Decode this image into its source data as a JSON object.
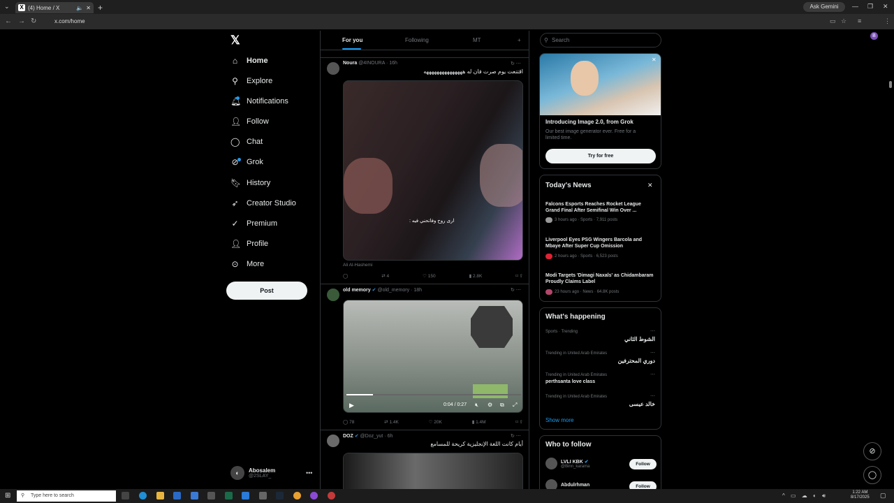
{
  "browser": {
    "tab_title": "(4) Home / X",
    "url": "x.com/home",
    "ask_gemini": "Ask Gemini",
    "profile_letter": "B"
  },
  "nav": {
    "items": [
      {
        "label": "Home",
        "icon": "home-icon"
      },
      {
        "label": "Explore",
        "icon": "search-icon"
      },
      {
        "label": "Notifications",
        "icon": "bell-icon"
      },
      {
        "label": "Follow",
        "icon": "person-add-icon"
      },
      {
        "label": "Chat",
        "icon": "chat-icon"
      },
      {
        "label": "Grok",
        "icon": "grok-icon"
      },
      {
        "label": "History",
        "icon": "bookmark-icon"
      },
      {
        "label": "Creator Studio",
        "icon": "rocket-icon"
      },
      {
        "label": "Premium",
        "icon": "verified-icon"
      },
      {
        "label": "Profile",
        "icon": "person-icon"
      },
      {
        "label": "More",
        "icon": "more-circle-icon"
      }
    ],
    "post_label": "Post",
    "account": {
      "name": "Abosalem",
      "handle": "@2SLAY_"
    }
  },
  "feed": {
    "tabs": [
      "For you",
      "Following",
      "MT"
    ],
    "tweets": [
      {
        "name": "Noura",
        "handle": "@4INOURA",
        "time": "16h",
        "text": "اقتنعت يوم صرت فان له هههههههههههههههه",
        "video_caption": "ارى روح وفاتحني فيه :",
        "credit": "Ali Al-Hashemi",
        "replies": "",
        "reposts": "4",
        "likes": "150",
        "views": "2.8K"
      },
      {
        "name": "old memory",
        "handle": "@old_memory",
        "time": "18h",
        "text": "",
        "video_time": "0:04 / 0:27",
        "replies": "78",
        "reposts": "1.4K",
        "likes": "20K",
        "views": "1.4M"
      },
      {
        "name": "DOZ",
        "handle": "@Doz_yut",
        "time": "6h",
        "text": "أيام كانت اللغة الإنجليزية كريحة للمسامع"
      }
    ]
  },
  "sidebar": {
    "search_placeholder": "Search",
    "promo": {
      "title": "Introducing Image 2.0, from Grok",
      "body": "Our best image generator ever. Free for a limited time.",
      "button": "Try for free"
    },
    "news": {
      "title": "Today's News",
      "items": [
        {
          "headline": "Falcons Esports Reaches Rocket League Grand Final After Semifinal Win Over ...",
          "meta": "3 hours ago · Sports · 7,911 posts"
        },
        {
          "headline": "Liverpool Eyes PSG Wingers Barcola and Mbaye After Super Cup Omission",
          "meta": "2 hours ago · Sports · 6,523 posts"
        },
        {
          "headline": "Modi Targets 'Dimagi Naxals' as Chidambaram Proudly Claims Label",
          "meta": "23 hours ago · News · 64.8K posts"
        }
      ]
    },
    "trends": {
      "title": "What's happening",
      "items": [
        {
          "context": "Sports · Trending",
          "topic": "الشوط الثاني"
        },
        {
          "context": "Trending in United Arab Emirates",
          "topic": "دوري المحترفين"
        },
        {
          "context": "Trending in United Arab Emirates",
          "topic": "perthsanta love class"
        },
        {
          "context": "Trending in United Arab Emirates",
          "topic": "خالد عيسى"
        }
      ],
      "show_more": "Show more"
    },
    "who_to_follow": {
      "title": "Who to follow",
      "items": [
        {
          "name": "LVLI KBK",
          "handle": "@Binn_karama",
          "button": "Follow"
        },
        {
          "name": "Abdulrhman",
          "handle": "",
          "button": "Follow"
        }
      ]
    }
  },
  "taskbar": {
    "search_placeholder": "Type here to search",
    "time": "1:22 AM",
    "date": "8/17/2025"
  }
}
